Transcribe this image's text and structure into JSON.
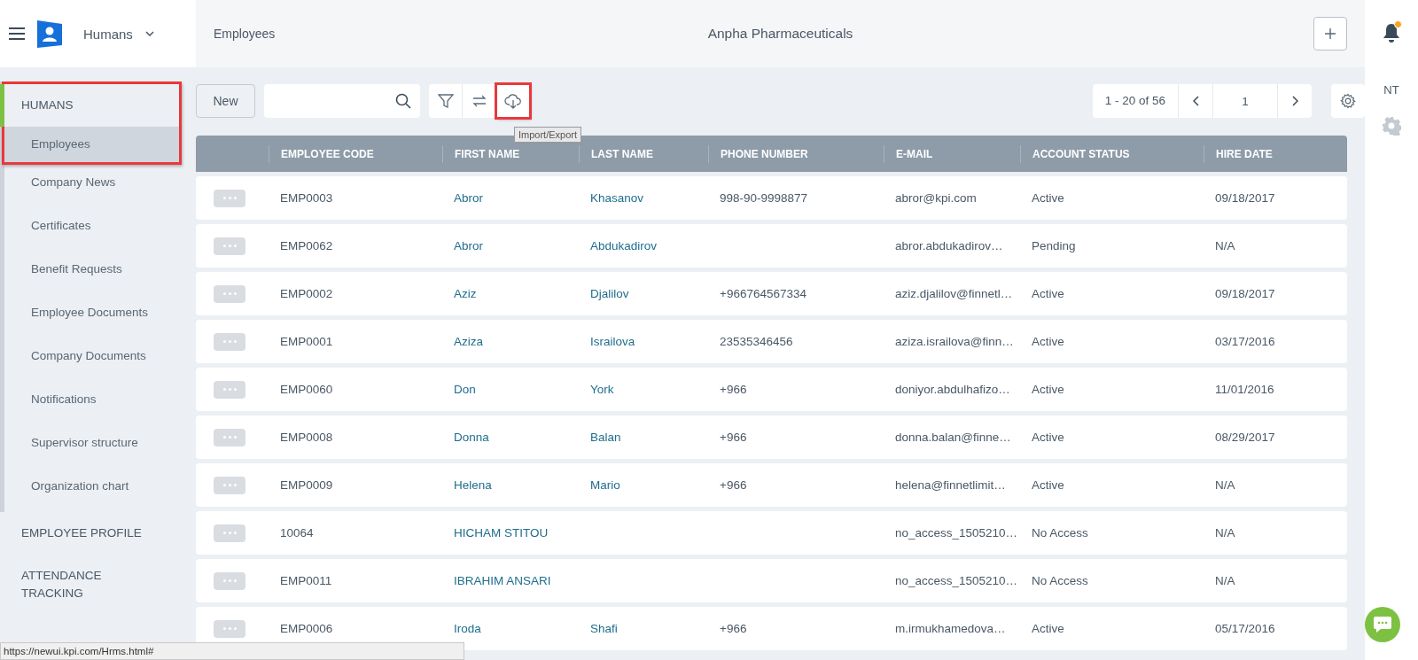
{
  "header": {
    "app_switcher": "Humans",
    "breadcrumb": "Employees",
    "company": "Anpha Pharmaceuticals",
    "notifications": {
      "unread": true
    }
  },
  "right_rail": {
    "initials": "NT"
  },
  "sidebar": {
    "sections": [
      {
        "label": "HUMANS",
        "annotated": true,
        "items": [
          {
            "label": "Employees",
            "selected": true
          },
          {
            "label": "Company News",
            "selected": false
          },
          {
            "label": "Certificates",
            "selected": false
          },
          {
            "label": "Benefit Requests",
            "selected": false
          },
          {
            "label": "Employee Documents",
            "selected": false
          },
          {
            "label": "Company Documents",
            "selected": false
          },
          {
            "label": "Notifications",
            "selected": false
          },
          {
            "label": "Supervisor structure",
            "selected": false
          },
          {
            "label": "Organization chart",
            "selected": false
          }
        ]
      },
      {
        "label": "EMPLOYEE PROFILE",
        "annotated": false
      },
      {
        "label": "ATTENDANCE TRACKING",
        "annotated": false
      }
    ]
  },
  "toolbar": {
    "new_button": "New",
    "tools": [
      {
        "kind": "filter",
        "annotated": false
      },
      {
        "kind": "swap",
        "annotated": false
      },
      {
        "kind": "import",
        "annotated": true,
        "tooltip": "Import/Export"
      }
    ],
    "pagination": {
      "range": "1 - 20 of 56",
      "page": "1"
    }
  },
  "table": {
    "columns": [
      "",
      "EMPLOYEE CODE",
      "FIRST NAME",
      "LAST NAME",
      "PHONE NUMBER",
      "E-MAIL",
      "ACCOUNT STATUS",
      "HIRE DATE"
    ],
    "rows": [
      [
        "",
        "EMP0003",
        "Abror",
        "Khasanov",
        "998-90-9998877",
        "abror@kpi.com",
        "Active",
        "09/18/2017"
      ],
      [
        "",
        "EMP0062",
        "Abror",
        "Abdukadirov",
        "",
        "abror.abdukadirov…",
        "Pending",
        "N/A"
      ],
      [
        "",
        "EMP0002",
        "Aziz",
        "Djalilov",
        "+966764567334",
        "aziz.djalilov@finnetl…",
        "Active",
        "09/18/2017"
      ],
      [
        "",
        "EMP0001",
        "Aziza",
        "Israilova",
        "23535346456",
        "aziza.israilova@finn…",
        "Active",
        "03/17/2016"
      ],
      [
        "",
        "EMP0060",
        "Don",
        "York",
        "+966",
        "doniyor.abdulhafizo…",
        "Active",
        "11/01/2016"
      ],
      [
        "",
        "EMP0008",
        "Donna",
        "Balan",
        "+966",
        "donna.balan@finne…",
        "Active",
        "08/29/2017"
      ],
      [
        "",
        "EMP0009",
        "Helena",
        "Mario",
        "+966",
        "helena@finnetlimit…",
        "Active",
        "N/A"
      ],
      [
        "",
        "10064",
        "HICHAM STITOU",
        "",
        "",
        "no_access_1505210…",
        "No Access",
        "N/A"
      ],
      [
        "",
        "EMP0011",
        "IBRAHIM ANSARI",
        "",
        "",
        "no_access_1505210…",
        "No Access",
        "N/A"
      ],
      [
        "",
        "EMP0006",
        "Iroda",
        "Shafi",
        "+966",
        "m.irmukhamedova…",
        "Active",
        "05/17/2016"
      ]
    ]
  },
  "status_bar": {
    "url": "https://newui.kpi.com/Hrms.html#"
  }
}
